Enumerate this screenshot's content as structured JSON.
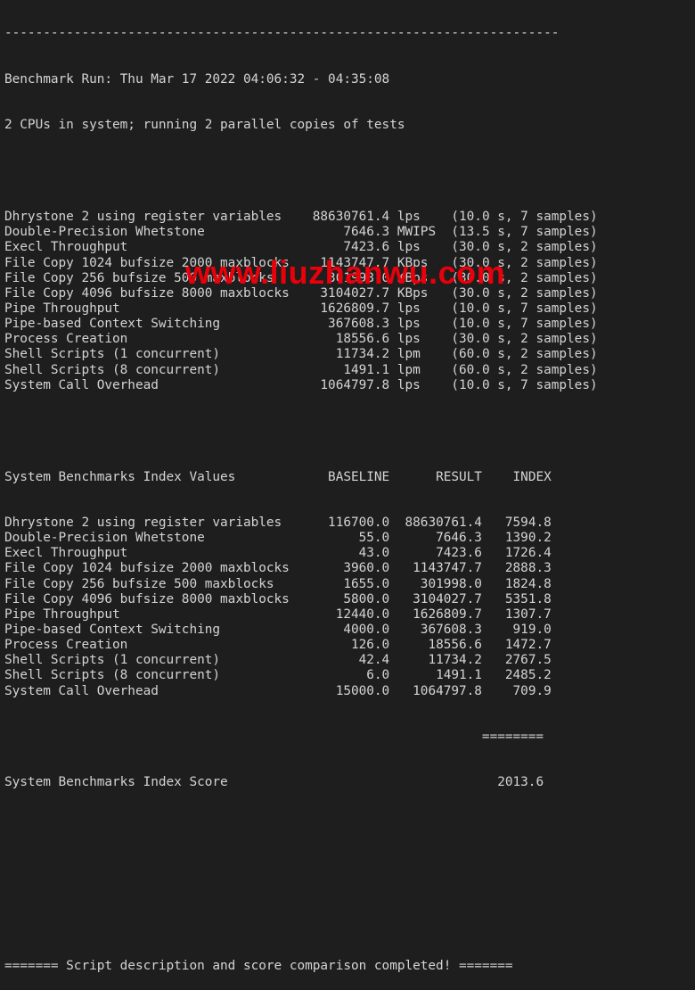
{
  "terminal": {
    "separator_top": "------------------------------------------------------------------------",
    "run_header": "Benchmark Run: Thu Mar 17 2022 04:06:32 - 04:35:08",
    "cpu_info": "2 CPUs in system; running 2 parallel copies of tests",
    "results": [
      {
        "name": "Dhrystone 2 using register variables",
        "value": "88630761.4",
        "unit": "lps",
        "detail": "(10.0 s, 7 samples)"
      },
      {
        "name": "Double-Precision Whetstone",
        "value": "7646.3",
        "unit": "MWIPS",
        "detail": "(13.5 s, 7 samples)"
      },
      {
        "name": "Execl Throughput",
        "value": "7423.6",
        "unit": "lps",
        "detail": "(30.0 s, 2 samples)"
      },
      {
        "name": "File Copy 1024 bufsize 2000 maxblocks",
        "value": "1143747.7",
        "unit": "KBps",
        "detail": "(30.0 s, 2 samples)"
      },
      {
        "name": "File Copy 256 bufsize 500 maxblocks",
        "value": "301998.0",
        "unit": "KBps",
        "detail": "(30.0 s, 2 samples)"
      },
      {
        "name": "File Copy 4096 bufsize 8000 maxblocks",
        "value": "3104027.7",
        "unit": "KBps",
        "detail": "(30.0 s, 2 samples)"
      },
      {
        "name": "Pipe Throughput",
        "value": "1626809.7",
        "unit": "lps",
        "detail": "(10.0 s, 7 samples)"
      },
      {
        "name": "Pipe-based Context Switching",
        "value": "367608.3",
        "unit": "lps",
        "detail": "(10.0 s, 7 samples)"
      },
      {
        "name": "Process Creation",
        "value": "18556.6",
        "unit": "lps",
        "detail": "(30.0 s, 2 samples)"
      },
      {
        "name": "Shell Scripts (1 concurrent)",
        "value": "11734.2",
        "unit": "lpm",
        "detail": "(60.0 s, 2 samples)"
      },
      {
        "name": "Shell Scripts (8 concurrent)",
        "value": "1491.1",
        "unit": "lpm",
        "detail": "(60.0 s, 2 samples)"
      },
      {
        "name": "System Call Overhead",
        "value": "1064797.8",
        "unit": "lps",
        "detail": "(10.0 s, 7 samples)"
      }
    ],
    "index_header": {
      "title": "System Benchmarks Index Values",
      "baseline": "BASELINE",
      "result": "RESULT",
      "index": "INDEX"
    },
    "index_rows": [
      {
        "name": "Dhrystone 2 using register variables",
        "baseline": "116700.0",
        "result": "88630761.4",
        "index": "7594.8"
      },
      {
        "name": "Double-Precision Whetstone",
        "baseline": "55.0",
        "result": "7646.3",
        "index": "1390.2"
      },
      {
        "name": "Execl Throughput",
        "baseline": "43.0",
        "result": "7423.6",
        "index": "1726.4"
      },
      {
        "name": "File Copy 1024 bufsize 2000 maxblocks",
        "baseline": "3960.0",
        "result": "1143747.7",
        "index": "2888.3"
      },
      {
        "name": "File Copy 256 bufsize 500 maxblocks",
        "baseline": "1655.0",
        "result": "301998.0",
        "index": "1824.8"
      },
      {
        "name": "File Copy 4096 bufsize 8000 maxblocks",
        "baseline": "5800.0",
        "result": "3104027.7",
        "index": "5351.8"
      },
      {
        "name": "Pipe Throughput",
        "baseline": "12440.0",
        "result": "1626809.7",
        "index": "1307.7"
      },
      {
        "name": "Pipe-based Context Switching",
        "baseline": "4000.0",
        "result": "367608.3",
        "index": "919.0"
      },
      {
        "name": "Process Creation",
        "baseline": "126.0",
        "result": "18556.6",
        "index": "1472.7"
      },
      {
        "name": "Shell Scripts (1 concurrent)",
        "baseline": "42.4",
        "result": "11734.2",
        "index": "2767.5"
      },
      {
        "name": "Shell Scripts (8 concurrent)",
        "baseline": "6.0",
        "result": "1491.1",
        "index": "2485.2"
      },
      {
        "name": "System Call Overhead",
        "baseline": "15000.0",
        "result": "1064797.8",
        "index": "709.9"
      }
    ],
    "score_separator": "========",
    "score_label": "System Benchmarks Index Score",
    "score_value": "2013.6",
    "completion_message": "======= Script description and score comparison completed! ======="
  },
  "watermark": {
    "text": "www.liuzhanwu.com",
    "color": "#e8000b"
  },
  "colors": {
    "background": "#1e1e1e",
    "text": "#d4d4d4"
  }
}
